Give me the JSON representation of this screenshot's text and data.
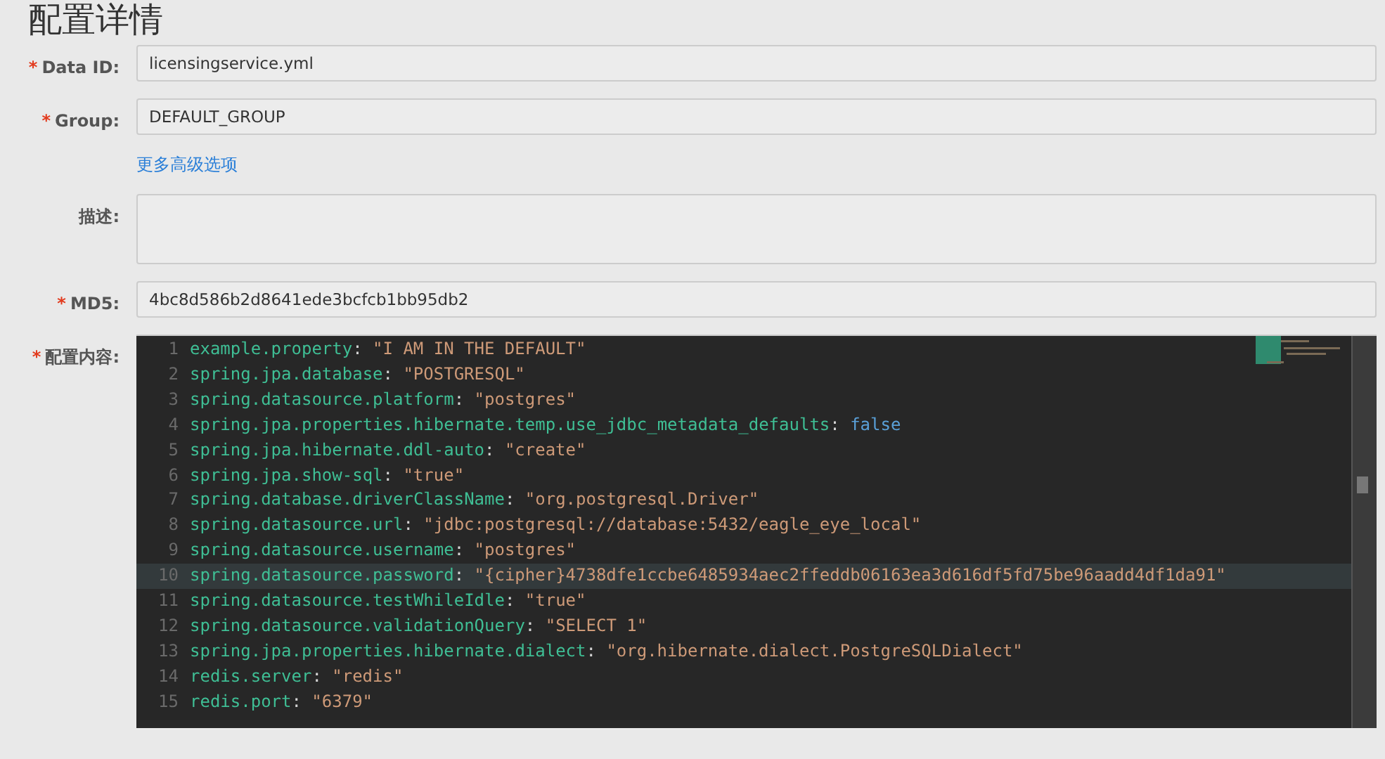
{
  "title": "配置详情",
  "fields": [
    {
      "label": "Data ID:",
      "required_mark": "*",
      "kind": "input",
      "value": "licensingservice.yml"
    },
    {
      "label": "Group:",
      "required_mark": "*",
      "kind": "input",
      "value": "DEFAULT_GROUP"
    },
    {
      "kind": "link",
      "text": "更多高级选项"
    },
    {
      "label": "描述:",
      "kind": "textarea"
    },
    {
      "label": "MD5:",
      "required_mark": "*",
      "kind": "input",
      "value": "4bc8d586b2d8641ede3bcfcb1bb95db2"
    },
    {
      "label": "配置内容:",
      "required_mark": "*",
      "kind": "editor"
    }
  ],
  "editor": {
    "lines": [
      {
        "number": "1",
        "key": "example.property",
        "separator": ":",
        "value": "\"I AM IN THE DEFAULT\"",
        "kind": "string",
        "highlighted": false
      },
      {
        "number": "2",
        "key": "spring.jpa.database",
        "separator": ":",
        "value": "\"POSTGRESQL\"",
        "kind": "string",
        "highlighted": false
      },
      {
        "number": "3",
        "key": "spring.datasource.platform",
        "separator": ":",
        "value": "\"postgres\"",
        "kind": "string",
        "highlighted": false
      },
      {
        "number": "4",
        "key": "spring.jpa.properties.hibernate.temp.use_jdbc_metadata_defaults",
        "separator": ":",
        "value": "false",
        "kind": "boolean",
        "highlighted": false
      },
      {
        "number": "5",
        "key": "spring.jpa.hibernate.ddl-auto",
        "separator": ":",
        "value": "\"create\"",
        "kind": "string",
        "highlighted": false
      },
      {
        "number": "6",
        "key": "spring.jpa.show-sql",
        "separator": ":",
        "value": "\"true\"",
        "kind": "string",
        "highlighted": false
      },
      {
        "number": "7",
        "key": "spring.database.driverClassName",
        "separator": ":",
        "value": "\"org.postgresql.Driver\"",
        "kind": "string",
        "highlighted": false
      },
      {
        "number": "8",
        "key": "spring.datasource.url",
        "separator": ":",
        "value": "\"jdbc:postgresql://database:5432/eagle_eye_local\"",
        "kind": "string",
        "highlighted": false
      },
      {
        "number": "9",
        "key": "spring.datasource.username",
        "separator": ":",
        "value": "\"postgres\"",
        "kind": "string",
        "highlighted": false
      },
      {
        "number": "10",
        "key": "spring.datasource.password",
        "separator": ":",
        "value": "\"{cipher}4738dfe1ccbe6485934aec2ffeddb06163ea3d616df5fd75be96aadd4df1da91\"",
        "kind": "string",
        "highlighted": true
      },
      {
        "number": "11",
        "key": "spring.datasource.testWhileIdle",
        "separator": ":",
        "value": "\"true\"",
        "kind": "string",
        "highlighted": false
      },
      {
        "number": "12",
        "key": "spring.datasource.validationQuery",
        "separator": ":",
        "value": "\"SELECT 1\"",
        "kind": "string",
        "highlighted": false
      },
      {
        "number": "13",
        "key": "spring.jpa.properties.hibernate.dialect",
        "separator": ":",
        "value": "\"org.hibernate.dialect.PostgreSQLDialect\"",
        "kind": "string",
        "highlighted": false
      },
      {
        "number": "14",
        "key": "redis.server",
        "separator": ":",
        "value": "\"redis\"",
        "kind": "string",
        "highlighted": false
      },
      {
        "number": "15",
        "key": "redis.port",
        "separator": ":",
        "value": "\"6379\"",
        "kind": "string",
        "highlighted": false
      }
    ]
  }
}
